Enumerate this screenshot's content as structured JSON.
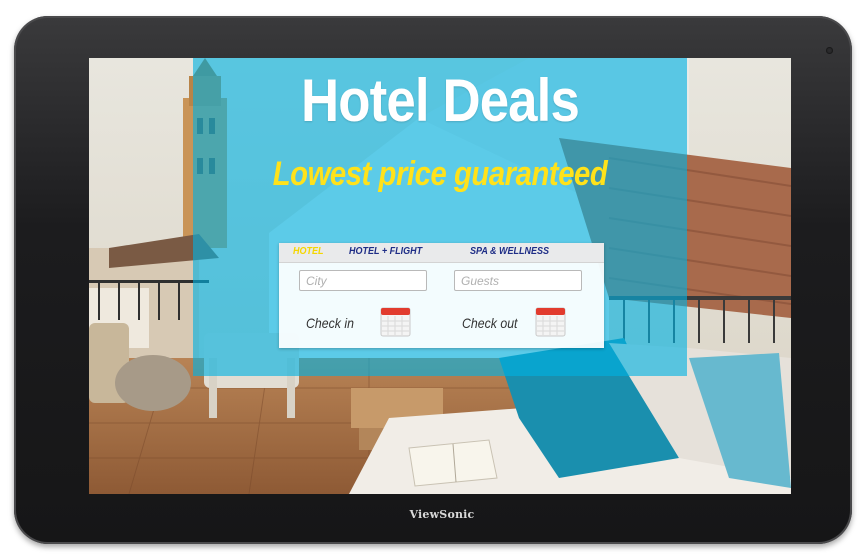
{
  "hero": {
    "title": "Hotel Deals",
    "tagline": "Lowest price guaranteed"
  },
  "booking": {
    "tabs": [
      {
        "label": "HOTEL",
        "active": true
      },
      {
        "label": "HOTEL + FLIGHT",
        "active": false
      },
      {
        "label": "SPA & WELLNESS",
        "active": false
      }
    ],
    "city_placeholder": "City",
    "guests_placeholder": "Guests",
    "checkin_label": "Check in",
    "checkout_label": "Check out",
    "calendar_icon": "calendar-icon"
  },
  "device": {
    "brand": "ViewSonic"
  },
  "colors": {
    "overlay": "#00b2e2",
    "title": "#ffffff",
    "tagline": "#ffe21a",
    "tab_active": "#f4d600",
    "tab_inactive": "#1e2d86",
    "calendar_header": "#e23b2e"
  }
}
